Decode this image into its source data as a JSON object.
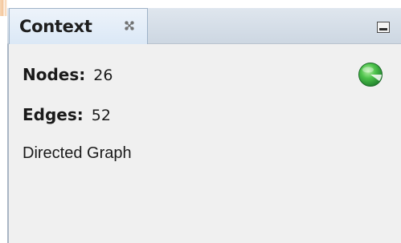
{
  "panel": {
    "tab_title": "Context",
    "close_icon": "close-icon",
    "minimize_icon": "minimize-icon"
  },
  "stats": {
    "nodes_label": "Nodes:",
    "nodes_value": "26",
    "edges_label": "Edges:",
    "edges_value": "52",
    "graph_type": "Directed Graph"
  },
  "status": {
    "icon": "status-indicator-icon",
    "color": "#2aa84a"
  },
  "colors": {
    "panel_background": "#f0f0f0",
    "tab_background": "#dbe8f6",
    "tabbar_background": "#cdd7e2"
  }
}
